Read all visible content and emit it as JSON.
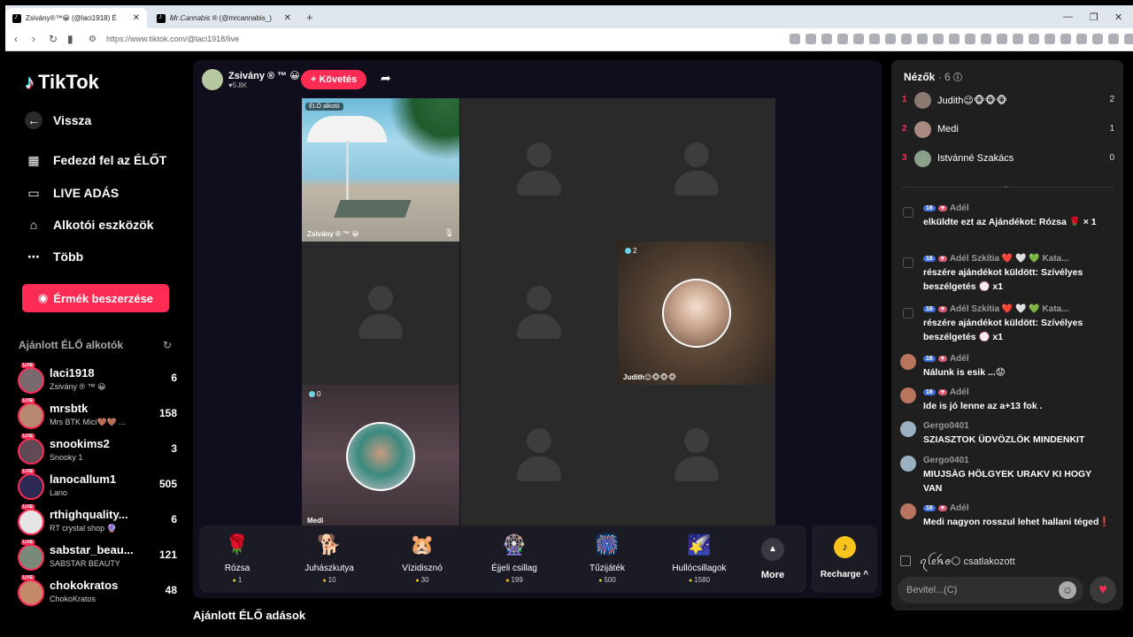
{
  "browser": {
    "tabs": [
      {
        "title": "Zsivány®™😀 (@laci1918) É"
      },
      {
        "title": "𝑀𝑟.𝐶𝑎𝑛𝑛𝑎𝑏𝑖𝑠 ® (@mrcannabis_)"
      }
    ],
    "url": "https://www.tiktok.com/@laci1918/live"
  },
  "sidebar": {
    "logo": "TikTok",
    "nav": [
      {
        "label": "Vissza",
        "icon": "arrow-left-icon"
      },
      {
        "label": "Fedezd fel az ÉLŐT",
        "icon": "calendar-icon"
      },
      {
        "label": "LIVE ADÁS",
        "icon": "video-camera-icon"
      },
      {
        "label": "Alkotói eszközök",
        "icon": "lightbulb-icon"
      },
      {
        "label": "Több",
        "icon": "more-icon"
      }
    ],
    "coins_button": "Érmék beszerzése",
    "recommended_title": "Ajánlott ÉLŐ alkotók",
    "creators": [
      {
        "name": "laci1918",
        "sub": "Zsivány ® ™ 😀",
        "count": "6"
      },
      {
        "name": "mrsbtk",
        "sub": "Mrs BTK Mici🤎🤎 ...",
        "count": "158"
      },
      {
        "name": "snookims2",
        "sub": "Snooky 1",
        "count": "3"
      },
      {
        "name": "lanocallum1",
        "sub": "Lano",
        "count": "505"
      },
      {
        "name": "rthighquality...",
        "sub": "RT crystal shop 🔮",
        "count": "6"
      },
      {
        "name": "sabstar_beau...",
        "sub": "SABSTAR BEAUTY",
        "count": "121"
      },
      {
        "name": "chokokratos",
        "sub": "ChokoKratos",
        "count": "48"
      }
    ],
    "live_badge": "LIVE"
  },
  "stream": {
    "host_name": "Zsivány ® ™ 😀",
    "host_likes": "♥5.8K",
    "follow_label": "+ Követés",
    "cells": {
      "c1_tag": "ÉLŐ alkotó",
      "c1_label": "Zsivány ® ™ 😀",
      "c6_badge": "2",
      "c6_label": "Judith😉🐵🐵🐵",
      "c7_badge": "0",
      "c7_label": "Medi"
    },
    "gifts": [
      {
        "name": "Rózsa",
        "price": "1",
        "icon": "🌹"
      },
      {
        "name": "Juhászkutya",
        "price": "10",
        "icon": "🐕"
      },
      {
        "name": "Vízidisznó",
        "price": "30",
        "icon": "🐹"
      },
      {
        "name": "Éjjeli csillag",
        "price": "199",
        "icon": "🎡"
      },
      {
        "name": "Tűzijáték",
        "price": "500",
        "icon": "🎆"
      },
      {
        "name": "Hullócsillagok",
        "price": "1580",
        "icon": "🌠"
      }
    ],
    "more_label": "More",
    "recharge_label": "Recharge ^",
    "recommended_live": "Ajánlott ÉLŐ adások"
  },
  "chat": {
    "viewers_title": "Nézők",
    "viewers_count": "· 6",
    "viewers": [
      {
        "rank": "1",
        "name": "Judith😉🐵🐵🐵",
        "score": "2"
      },
      {
        "rank": "2",
        "name": "Medi",
        "score": "1"
      },
      {
        "rank": "3",
        "name": "Istvánné Szakács",
        "score": "0"
      }
    ],
    "messages": [
      {
        "level": "16",
        "heart": "♥",
        "user": "Adél",
        "text": "elküldte ezt az Ajándékot: Rózsa 🌹 × 1",
        "type": "gift"
      },
      {
        "level": "16",
        "heart": "♥",
        "user": "Adél Szkítia ❤️ 🤍 💚 Kata...",
        "text": "részére ajándékot küldött: Szívélyes beszélgetés 💮 x1",
        "type": "gift"
      },
      {
        "level": "16",
        "heart": "♥",
        "user": "Adél Szkítia ❤️ 🤍 💚 Kata...",
        "text": "részére ajándékot küldött: Szívélyes beszélgetés 💮 x1",
        "type": "gift"
      },
      {
        "level": "16",
        "heart": "♥",
        "user": "Adél",
        "text": "Nálunk is esik ...😟",
        "type": "user"
      },
      {
        "level": "16",
        "heart": "♥",
        "user": "Adél",
        "text": "Ide is jó lenne az a+13 fok .",
        "type": "user"
      },
      {
        "user": "Gergo0401",
        "text": "SZIASZTOK ÜDVÖZLÖK MINDENKIT",
        "type": "user2"
      },
      {
        "user": "Gergo0401",
        "text": "MIUJSÀG HÖLGYEK URAKV KI HOGY VAN",
        "type": "user2"
      },
      {
        "level": "16",
        "heart": "♥",
        "user": "Adél",
        "text": "Medi nagyon rosszul lehet hallani téged❗",
        "type": "user"
      }
    ],
    "joined_text": "ꪖꪶꫀꫝꪮ🌕 csatlakozott",
    "input_placeholder": "Bevitel...(C)"
  },
  "colors": {
    "accent": "#fe2c55",
    "panel": "#1f1f1f",
    "stage": "#100e1c"
  }
}
